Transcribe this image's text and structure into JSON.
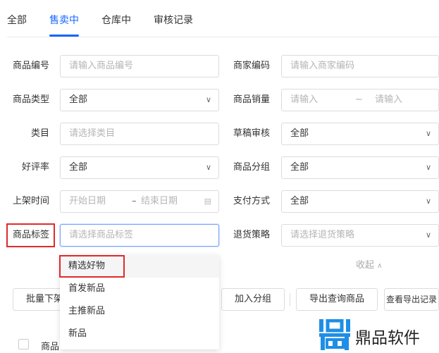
{
  "tabs": [
    {
      "label": "全部"
    },
    {
      "label": "售卖中",
      "active": true
    },
    {
      "label": "仓库中"
    },
    {
      "label": "审核记录"
    }
  ],
  "form": {
    "product_no": {
      "label": "商品编号",
      "placeholder": "请输入商品编号"
    },
    "merchant_code": {
      "label": "商家编码",
      "placeholder": "请输入商家编码"
    },
    "product_type": {
      "label": "商品类型",
      "value": "全部"
    },
    "sales": {
      "label": "商品销量",
      "min_placeholder": "请输入",
      "sep": "~",
      "max_placeholder": "请输入"
    },
    "category": {
      "label": "类目",
      "placeholder": "请选择类目"
    },
    "draft_review": {
      "label": "草稿审核",
      "value": "全部"
    },
    "rating": {
      "label": "好评率",
      "value": "全部"
    },
    "group": {
      "label": "商品分组",
      "value": "全部"
    },
    "listing_time": {
      "label": "上架时间",
      "start_placeholder": "开始日期",
      "sep": "–",
      "end_placeholder": "结束日期"
    },
    "payment": {
      "label": "支付方式",
      "value": "全部"
    },
    "tag": {
      "label": "商品标签",
      "placeholder": "请选择商品标签",
      "options": [
        "精选好物",
        "首发新品",
        "主推新品",
        "新品"
      ]
    },
    "return_policy": {
      "label": "退货策略",
      "placeholder": "请选择退货策略"
    },
    "collapse": "收起"
  },
  "actions": {
    "batch_delist": "批量下架",
    "add_group": "加入分组",
    "export_query": "导出查询商品",
    "view_export": "查看导出记录"
  },
  "table": {
    "header_product": "商品"
  },
  "watermark": {
    "text": "鼎品软件"
  },
  "colors": {
    "accent": "#1966ff",
    "highlight_box": "#e0292b",
    "logo": "#1e8fe6"
  }
}
